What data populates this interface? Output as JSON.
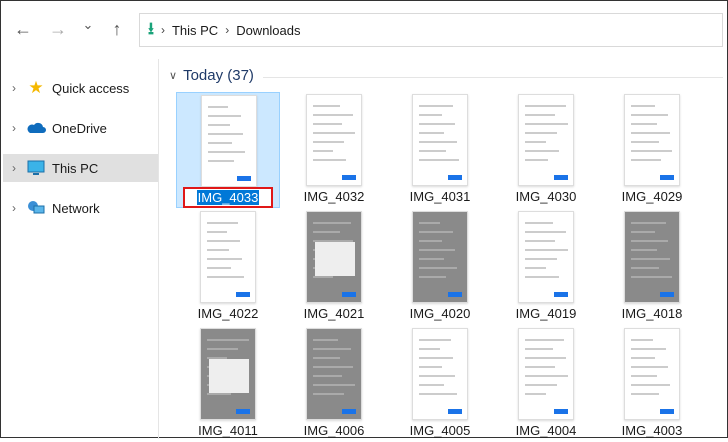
{
  "nav": {
    "back": "←",
    "forward": "→",
    "recent": "⌄",
    "up": "↑"
  },
  "address": {
    "crumbs": [
      "This PC",
      "Downloads"
    ]
  },
  "sidebar": {
    "items": [
      {
        "label": "Quick access",
        "icon": "star-icon"
      },
      {
        "label": "OneDrive",
        "icon": "cloud-icon"
      },
      {
        "label": "This PC",
        "icon": "monitor-icon",
        "selected": true
      },
      {
        "label": "Network",
        "icon": "network-icon"
      }
    ]
  },
  "group": {
    "title": "Today (37)"
  },
  "files": [
    {
      "name": "IMG_4033",
      "selected": true,
      "renaming": true,
      "dark": false
    },
    {
      "name": "IMG_4032",
      "dark": false
    },
    {
      "name": "IMG_4031",
      "dark": false
    },
    {
      "name": "IMG_4030",
      "dark": false
    },
    {
      "name": "IMG_4029",
      "dark": false
    },
    {
      "name": "IMG_4022",
      "dark": false
    },
    {
      "name": "IMG_4021",
      "dark": true
    },
    {
      "name": "IMG_4020",
      "dark": true
    },
    {
      "name": "IMG_4019",
      "dark": false
    },
    {
      "name": "IMG_4018",
      "dark": true
    },
    {
      "name": "IMG_4011",
      "dark": true
    },
    {
      "name": "IMG_4006",
      "dark": true
    },
    {
      "name": "IMG_4005",
      "dark": false
    },
    {
      "name": "IMG_4004",
      "dark": false
    },
    {
      "name": "IMG_4003",
      "dark": false
    }
  ]
}
